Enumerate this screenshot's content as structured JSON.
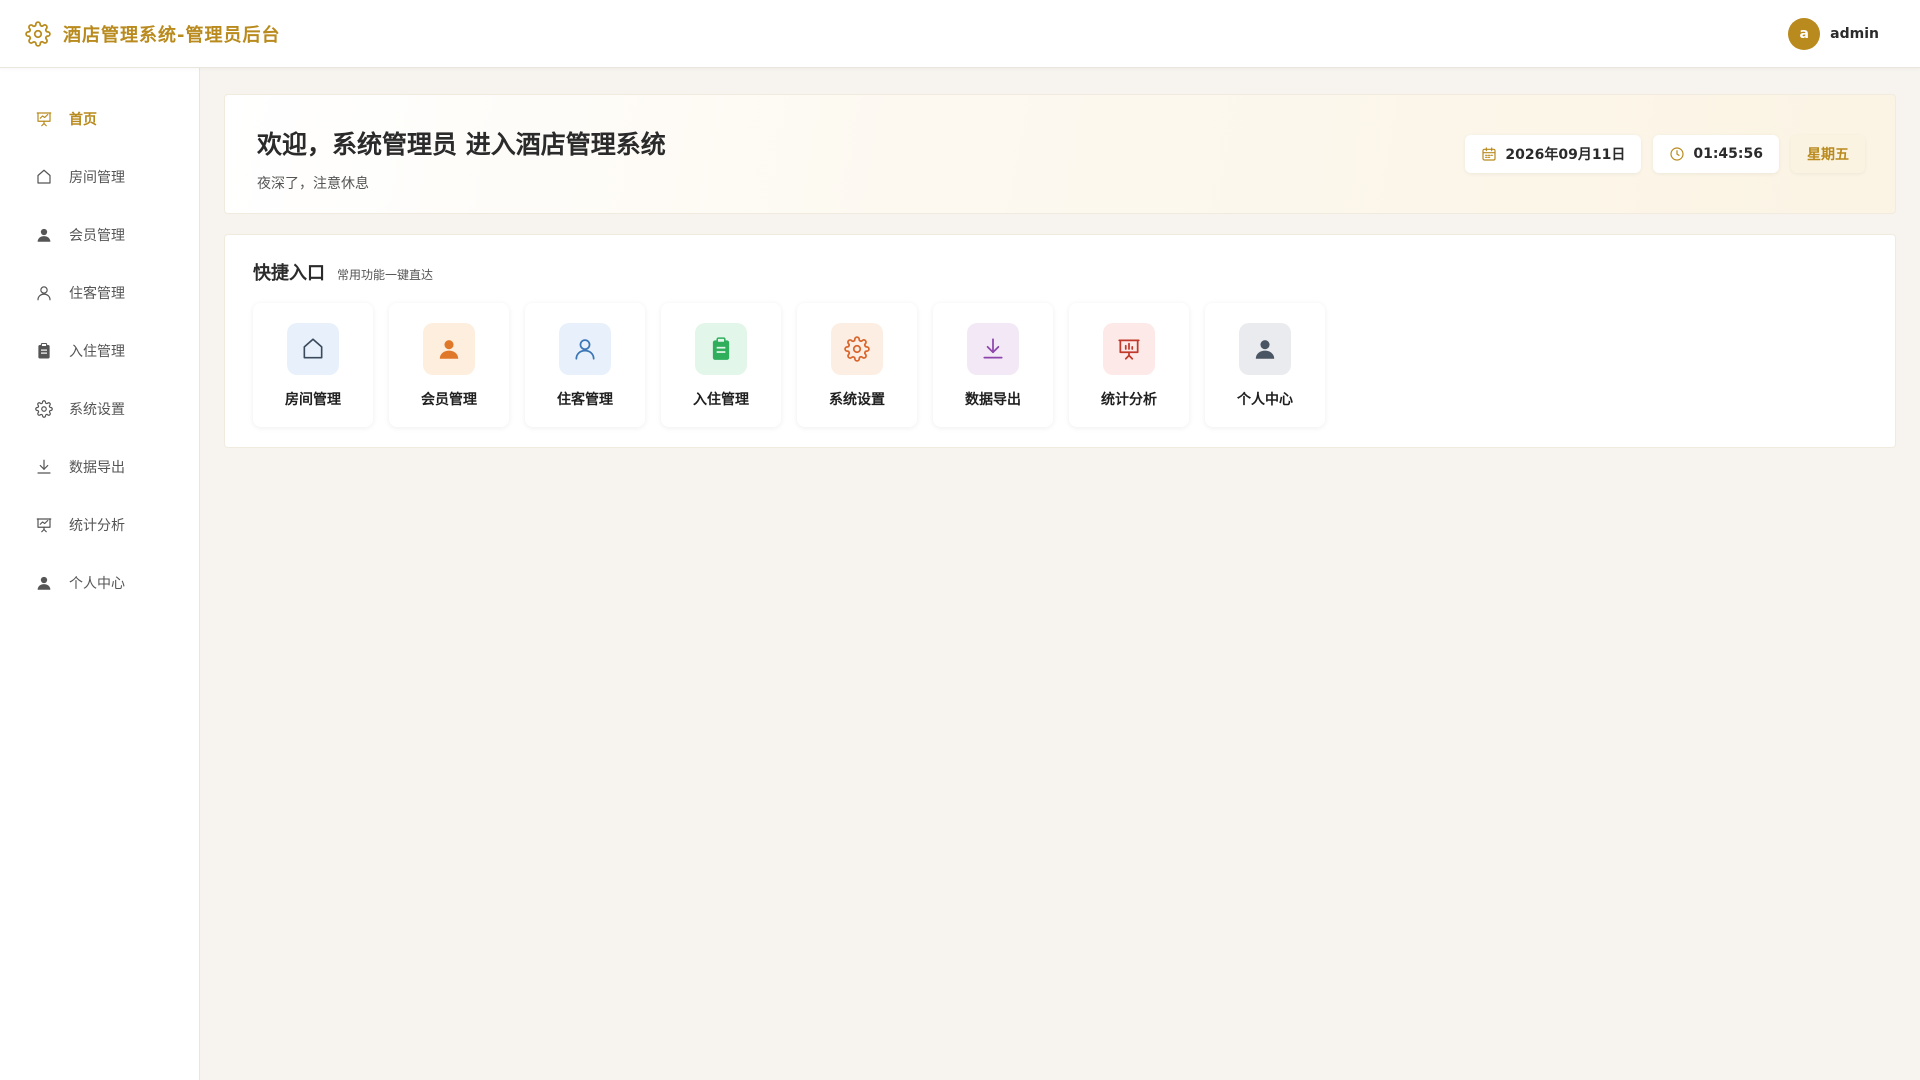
{
  "app": {
    "title": "酒店管理系统-管理员后台",
    "icon": "gear-icon",
    "accent_color": "#b98a1d"
  },
  "user": {
    "avatar_letter": "a",
    "name": "admin"
  },
  "sidebar": {
    "items": [
      {
        "label": "首页",
        "icon": "presentation-chart-icon",
        "active": true
      },
      {
        "label": "房间管理",
        "icon": "house-icon"
      },
      {
        "label": "会员管理",
        "icon": "person-filled-icon"
      },
      {
        "label": "住客管理",
        "icon": "person-outline-icon"
      },
      {
        "label": "入住管理",
        "icon": "clipboard-icon"
      },
      {
        "label": "系统设置",
        "icon": "gear-icon"
      },
      {
        "label": "数据导出",
        "icon": "download-icon"
      },
      {
        "label": "统计分析",
        "icon": "presentation-chart-icon"
      },
      {
        "label": "个人中心",
        "icon": "person-filled-icon"
      }
    ]
  },
  "welcome": {
    "title": "欢迎，系统管理员 进入酒店管理系统",
    "subtitle": "夜深了，注意休息",
    "date": "2026年09月11日",
    "time": "01:45:56",
    "weekday": "星期五"
  },
  "quick": {
    "title": "快捷入口",
    "subtitle": "常用功能一键直达",
    "cards": [
      {
        "label": "房间管理",
        "icon": "house-icon",
        "bg": "#e8f1fb",
        "color": "#3b4a5c"
      },
      {
        "label": "会员管理",
        "icon": "person-filled-icon",
        "bg": "#fdeede",
        "color": "#e0782a"
      },
      {
        "label": "住客管理",
        "icon": "person-outline-icon",
        "bg": "#e8f1fb",
        "color": "#3a75b5"
      },
      {
        "label": "入住管理",
        "icon": "clipboard-icon",
        "bg": "#e3f6ea",
        "color": "#2fae5c"
      },
      {
        "label": "系统设置",
        "icon": "gear-icon",
        "bg": "#fdeee4",
        "color": "#d9662c"
      },
      {
        "label": "数据导出",
        "icon": "download-icon",
        "bg": "#f3e9f6",
        "color": "#8e44ad"
      },
      {
        "label": "统计分析",
        "icon": "presentation-chart-icon",
        "bg": "#fde9e7",
        "color": "#c0392b"
      },
      {
        "label": "个人中心",
        "icon": "person-filled-icon",
        "bg": "#e9ebee",
        "color": "#4a5563"
      }
    ]
  }
}
